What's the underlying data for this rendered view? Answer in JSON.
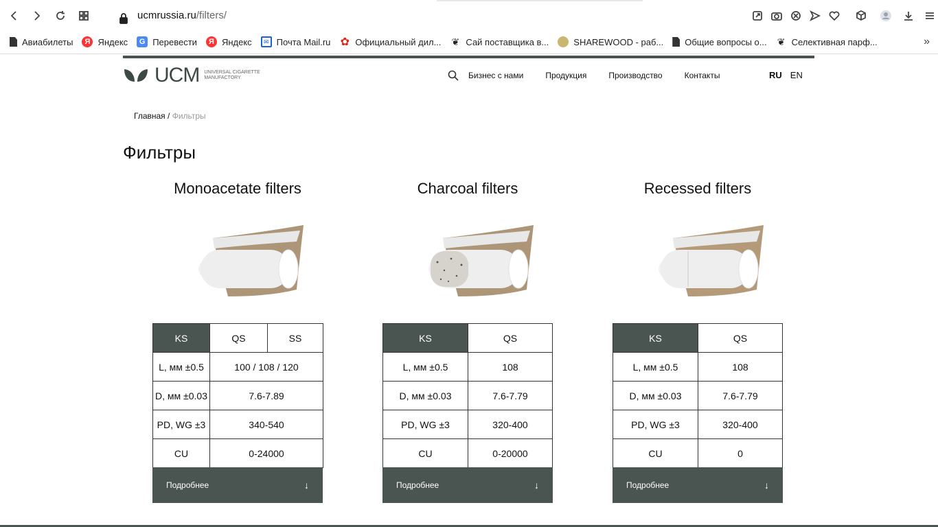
{
  "browser": {
    "url_host": "ucmrussia.ru",
    "url_path": "/filters/",
    "bookmarks": [
      {
        "label": "Авиабилеты",
        "icon": "document-icon"
      },
      {
        "label": "Яндекс",
        "icon": "yandex-icon"
      },
      {
        "label": "Перевести",
        "icon": "translate-icon"
      },
      {
        "label": "Яндекс",
        "icon": "yandex-icon"
      },
      {
        "label": "Почта Mail.ru",
        "icon": "mail-icon"
      },
      {
        "label": "Официальный дил...",
        "icon": "huawei-icon"
      },
      {
        "label": "Сай поставщика в...",
        "icon": "leaf-icon"
      },
      {
        "label": "SHAREWOOD - раб...",
        "icon": "sharewood-icon"
      },
      {
        "label": "Общие вопросы о...",
        "icon": "document-icon"
      },
      {
        "label": "Селективная парф...",
        "icon": "leaf-icon"
      }
    ],
    "more": "»"
  },
  "site": {
    "logo_text": "UCM",
    "logo_tagline": "UNIVERSAL CIGARETTE MANUFACTORY",
    "nav": [
      "Бизнес с нами",
      "Продукция",
      "Производство",
      "Контакты"
    ],
    "lang": [
      "RU",
      "EN"
    ],
    "accent": "#4a5552"
  },
  "breadcrumb": {
    "home": "Главная",
    "sep": "/",
    "current": "Фильтры"
  },
  "title": "Фильтры",
  "products": [
    {
      "name": "Monoacetate filters",
      "tabs": [
        "KS",
        "QS",
        "SS"
      ],
      "rows": [
        [
          "L, мм ±0.5",
          "100 / 108 / 120"
        ],
        [
          "D, мм ±0.03",
          "7.6-7.89"
        ],
        [
          "PD, WG ±3",
          "340-540"
        ],
        [
          "CU",
          "0-24000"
        ]
      ],
      "more": "Подробнее"
    },
    {
      "name": "Charcoal filters",
      "tabs": [
        "KS",
        "QS"
      ],
      "rows": [
        [
          "L, мм ±0.5",
          "108"
        ],
        [
          "D, мм ±0.03",
          "7.6-7.79"
        ],
        [
          "PD, WG ±3",
          "320-400"
        ],
        [
          "CU",
          "0-20000"
        ]
      ],
      "more": "Подробнее"
    },
    {
      "name": "Recessed filters",
      "tabs": [
        "KS",
        "QS"
      ],
      "rows": [
        [
          "L, мм ±0.5",
          "108"
        ],
        [
          "D, мм ±0.03",
          "7.6-7.79"
        ],
        [
          "PD, WG ±3",
          "320-400"
        ],
        [
          "CU",
          "0"
        ]
      ],
      "more": "Подробнее"
    }
  ]
}
